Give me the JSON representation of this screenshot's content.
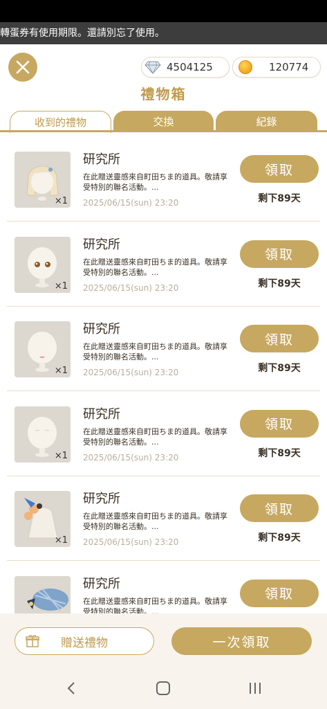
{
  "notice": "轉蛋券有使用期限。還請別忘了使用。",
  "currency": {
    "gems": "4504125",
    "coins": "120774"
  },
  "title": "禮物箱",
  "tabs": [
    "收到的禮物",
    "交換",
    "紀錄"
  ],
  "items": [
    {
      "title": "研究所",
      "desc": "在此贈送靈感來自町田ちま的道具。敬請享受特別的聯名活動。...",
      "date": "2025/06/15(sun) 23:20",
      "qty": "×1",
      "button": "領取",
      "remain": "剩下89天",
      "thumb": "hair-icon"
    },
    {
      "title": "研究所",
      "desc": "在此贈送靈感來自町田ちま的道具。敬請享受特別的聯名活動。...",
      "date": "2025/06/15(sun) 23:20",
      "qty": "×1",
      "button": "領取",
      "remain": "剩下89天",
      "thumb": "eyes-icon"
    },
    {
      "title": "研究所",
      "desc": "在此贈送靈感來自町田ちま的道具。敬請享受特別的聯名活動。...",
      "date": "2025/06/15(sun) 23:20",
      "qty": "×1",
      "button": "領取",
      "remain": "剩下89天",
      "thumb": "mouth-icon"
    },
    {
      "title": "研究所",
      "desc": "在此贈送靈感來自町田ちま的道具。敬請享受特別的聯名活動。...",
      "date": "2025/06/15(sun) 23:20",
      "qty": "×1",
      "button": "領取",
      "remain": "剩下89天",
      "thumb": "face-icon"
    },
    {
      "title": "研究所",
      "desc": "在此贈送靈感來自町田ちま的道具。敬請享受特別的聯名活動。...",
      "date": "2025/06/15(sun) 23:20",
      "qty": "×1",
      "button": "領取",
      "remain": "剩下89天",
      "thumb": "outfit-icon"
    },
    {
      "title": "研究所",
      "desc": "在此贈送靈感來自町田ちま的道具。敬請享受特別的聯名活動。...",
      "date": "",
      "qty": "",
      "button": "領取",
      "remain": "",
      "thumb": "hat-icon"
    }
  ],
  "footer": {
    "gift_label": "贈送禮物",
    "claim_all_label": "一次領取"
  },
  "colors": {
    "accent": "#c6a860",
    "title": "#c09a4a",
    "text": "#3a3025",
    "muted": "#b9ae9c"
  }
}
